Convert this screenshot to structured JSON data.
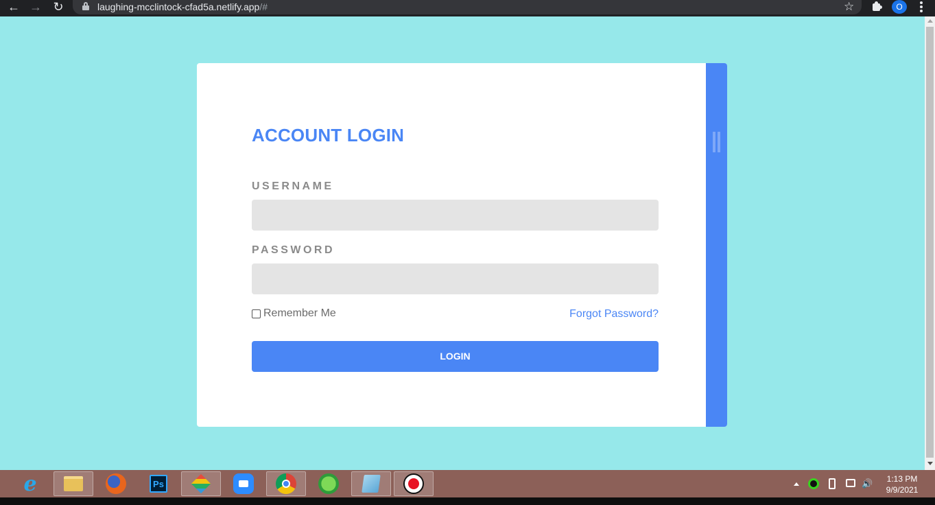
{
  "browser": {
    "url_host": "laughing-mcclintock-cfad5a.netlify.app",
    "url_path": "/#",
    "profile_initial": "O",
    "icons": [
      "back-arrow-icon",
      "forward-arrow-icon",
      "reload-icon",
      "lock-icon",
      "star-icon",
      "puzzle-icon",
      "kebab-menu-icon"
    ]
  },
  "login": {
    "title": "ACCOUNT LOGIN",
    "username_label": "USERNAME",
    "username_value": "",
    "password_label": "PASSWORD",
    "password_value": "",
    "remember_label": "Remember Me",
    "remember_checked": false,
    "forgot_label": "Forgot Password?",
    "submit_label": "LOGIN"
  },
  "colors": {
    "page_background": "#96e8ea",
    "accent": "#4a86f5",
    "field_background": "#e4e4e4",
    "label_gray": "#8a8a8a",
    "taskbar": "#8c6058"
  },
  "taskbar": {
    "apps": [
      {
        "name": "internet-explorer-icon",
        "glyph": "e",
        "active": false
      },
      {
        "name": "file-explorer-icon",
        "glyph": "",
        "active": true
      },
      {
        "name": "firefox-icon",
        "glyph": "",
        "active": false
      },
      {
        "name": "photoshop-icon",
        "glyph": "Ps",
        "active": false
      },
      {
        "name": "git-icon",
        "glyph": "",
        "active": true
      },
      {
        "name": "zoom-icon",
        "glyph": "",
        "active": false
      },
      {
        "name": "chrome-icon",
        "glyph": "",
        "active": true
      },
      {
        "name": "green-app-icon",
        "glyph": "",
        "active": false
      },
      {
        "name": "notepad-icon",
        "glyph": "",
        "active": true
      },
      {
        "name": "screen-recorder-icon",
        "glyph": "",
        "active": true
      }
    ],
    "time": "1:13 PM",
    "date": "9/9/2021"
  }
}
